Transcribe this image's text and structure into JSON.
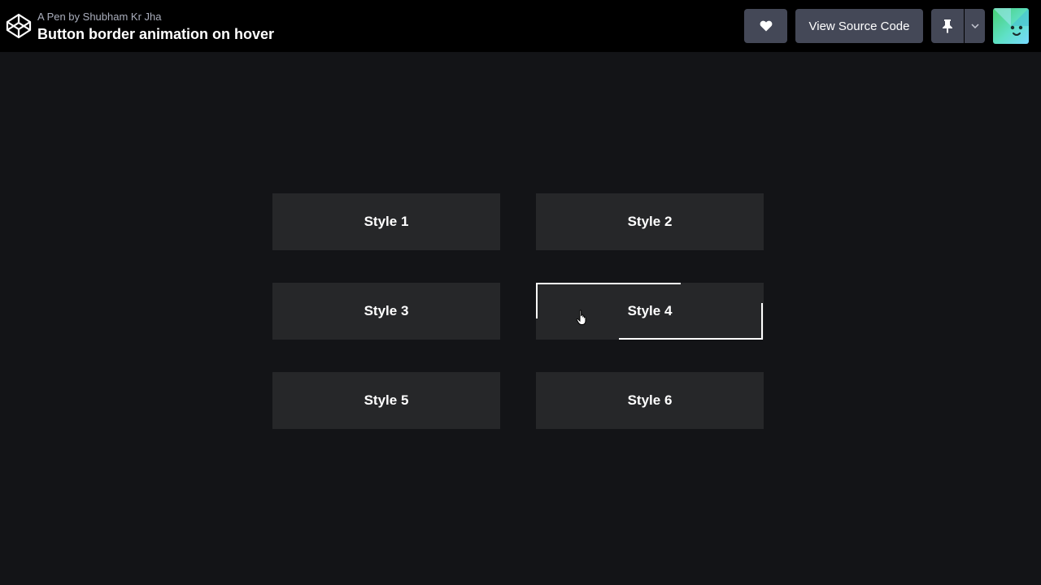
{
  "header": {
    "byline": "A Pen by Shubham Kr Jha",
    "title": "Button border animation on hover",
    "logo_icon": "codepen-logo-icon",
    "heart_icon": "heart-icon",
    "view_source_label": "View Source Code",
    "pin_icon": "pin-icon",
    "caret_icon": "chevron-down-icon",
    "avatar_icon": "user-avatar"
  },
  "main": {
    "buttons": [
      {
        "label": "Style 1"
      },
      {
        "label": "Style 2"
      },
      {
        "label": "Style 3"
      },
      {
        "label": "Style 4",
        "state": "hover"
      },
      {
        "label": "Style 5"
      },
      {
        "label": "Style 6"
      }
    ]
  },
  "colors": {
    "page_bg": "#131417",
    "topbar_bg": "#000000",
    "header_button_bg": "#444857",
    "grid_button_bg": "#262729",
    "hover_border": "#ffffff"
  }
}
